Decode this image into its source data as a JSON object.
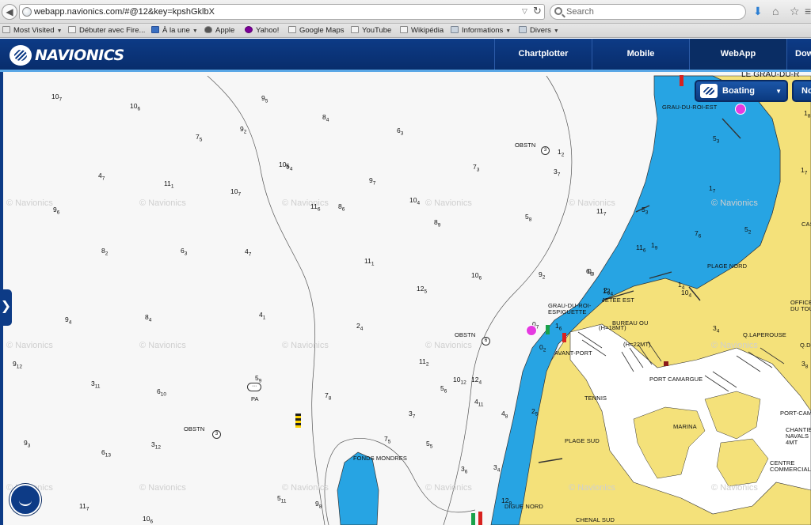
{
  "browser": {
    "url": "webapp.navionics.com/#@12&key=kpshGklbX",
    "search_placeholder": "Search",
    "bookmarks": [
      {
        "label": "Most Visited",
        "icon": "star-icon"
      },
      {
        "label": "Débuter avec Fire...",
        "icon": "page-icon"
      },
      {
        "label": "À la une",
        "icon": "news-icon"
      },
      {
        "label": "Apple",
        "icon": "apple-icon"
      },
      {
        "label": "Yahoo!",
        "icon": "yahoo-icon"
      },
      {
        "label": "Google Maps",
        "icon": "page-icon"
      },
      {
        "label": "YouTube",
        "icon": "page-icon"
      },
      {
        "label": "Wikipédia",
        "icon": "page-icon"
      },
      {
        "label": "Informations",
        "icon": "folder-icon"
      },
      {
        "label": "Divers",
        "icon": "folder-icon"
      }
    ]
  },
  "header": {
    "brand": "NAVIONICS",
    "tabs": [
      {
        "label": "Chartplotter",
        "active": false
      },
      {
        "label": "Mobile",
        "active": false
      },
      {
        "label": "WebApp",
        "active": true
      },
      {
        "label": "Dow",
        "active": false
      }
    ]
  },
  "map_controls": {
    "layer_label": "Boating",
    "layer2_label": "No",
    "side_toggle": "❯"
  },
  "map": {
    "watermark": "© Navionics",
    "place_labels": [
      "LE GRAU-DU-R",
      "GRAU-DU-ROI-EST",
      "PLAGE NORD",
      "JETEE EST",
      "GRAU-DU-ROI-",
      "ESPIGUETTE",
      "BUREAU OU",
      "(H=18MT)",
      "(H=22MT)",
      "AVANT-PORT",
      "PORT CAMARGUE",
      "Q.LAPEROUSE",
      "TENNIS",
      "MARINA",
      "PLAGE SUD",
      "FONDS MONDRES",
      "DIGUE NORD",
      "CHENAL SUD",
      "OBSTN",
      "PA",
      "OFFICE",
      "DU TOU",
      "CAS",
      "CHANTIE",
      "NAVALS",
      "4MT",
      "CENTRE",
      "COMMERCIAL",
      "PORT-CAM",
      "Q.D"
    ],
    "soundings": [
      "10",
      "7",
      "10",
      "6",
      "9",
      "5",
      "7",
      "5",
      "5",
      "4",
      "8",
      "6",
      "10",
      "4",
      "9",
      "2",
      "8",
      "4",
      "6",
      "3",
      "4",
      "7",
      "11",
      "1",
      "10",
      "7",
      "10",
      "5",
      "9",
      "7",
      "8",
      "9",
      "7",
      "3",
      "5",
      "8",
      "3",
      "7",
      "11",
      "7",
      "9",
      "6",
      "8",
      "2",
      "6",
      "3",
      "4",
      "7",
      "11",
      "6",
      "11",
      "1",
      "10",
      "6",
      "9",
      "2",
      "6",
      "9",
      "5",
      "3",
      "12",
      "5",
      "12",
      "4",
      "11",
      "6",
      "10",
      "4",
      "9",
      "4",
      "8",
      "4",
      "4",
      "1",
      "2",
      "4",
      "11",
      "2",
      "10",
      "12",
      "9",
      "12",
      "3",
      "11",
      "6",
      "10",
      "5",
      "9",
      "7",
      "8",
      "3",
      "7",
      "5",
      "6",
      "4",
      "11",
      "4",
      "8",
      "2",
      "5",
      "9",
      "3",
      "6",
      "13",
      "3",
      "12",
      "5",
      "11",
      "9",
      "8",
      "7",
      "5",
      "5",
      "5",
      "3",
      "6",
      "3",
      "4",
      "12",
      "9",
      "11",
      "7",
      "10",
      "6",
      "12",
      "4",
      "7",
      "6",
      "5",
      "3",
      "5",
      "2",
      "1",
      "4",
      "1",
      "9",
      "1",
      "2",
      "0",
      "7",
      "0",
      "2",
      "1",
      "6",
      "0",
      "3",
      "2",
      "3",
      "3",
      "4",
      "1",
      "7",
      "1",
      "9",
      "1",
      "8",
      "1",
      "7",
      "3",
      "8",
      "6"
    ]
  }
}
